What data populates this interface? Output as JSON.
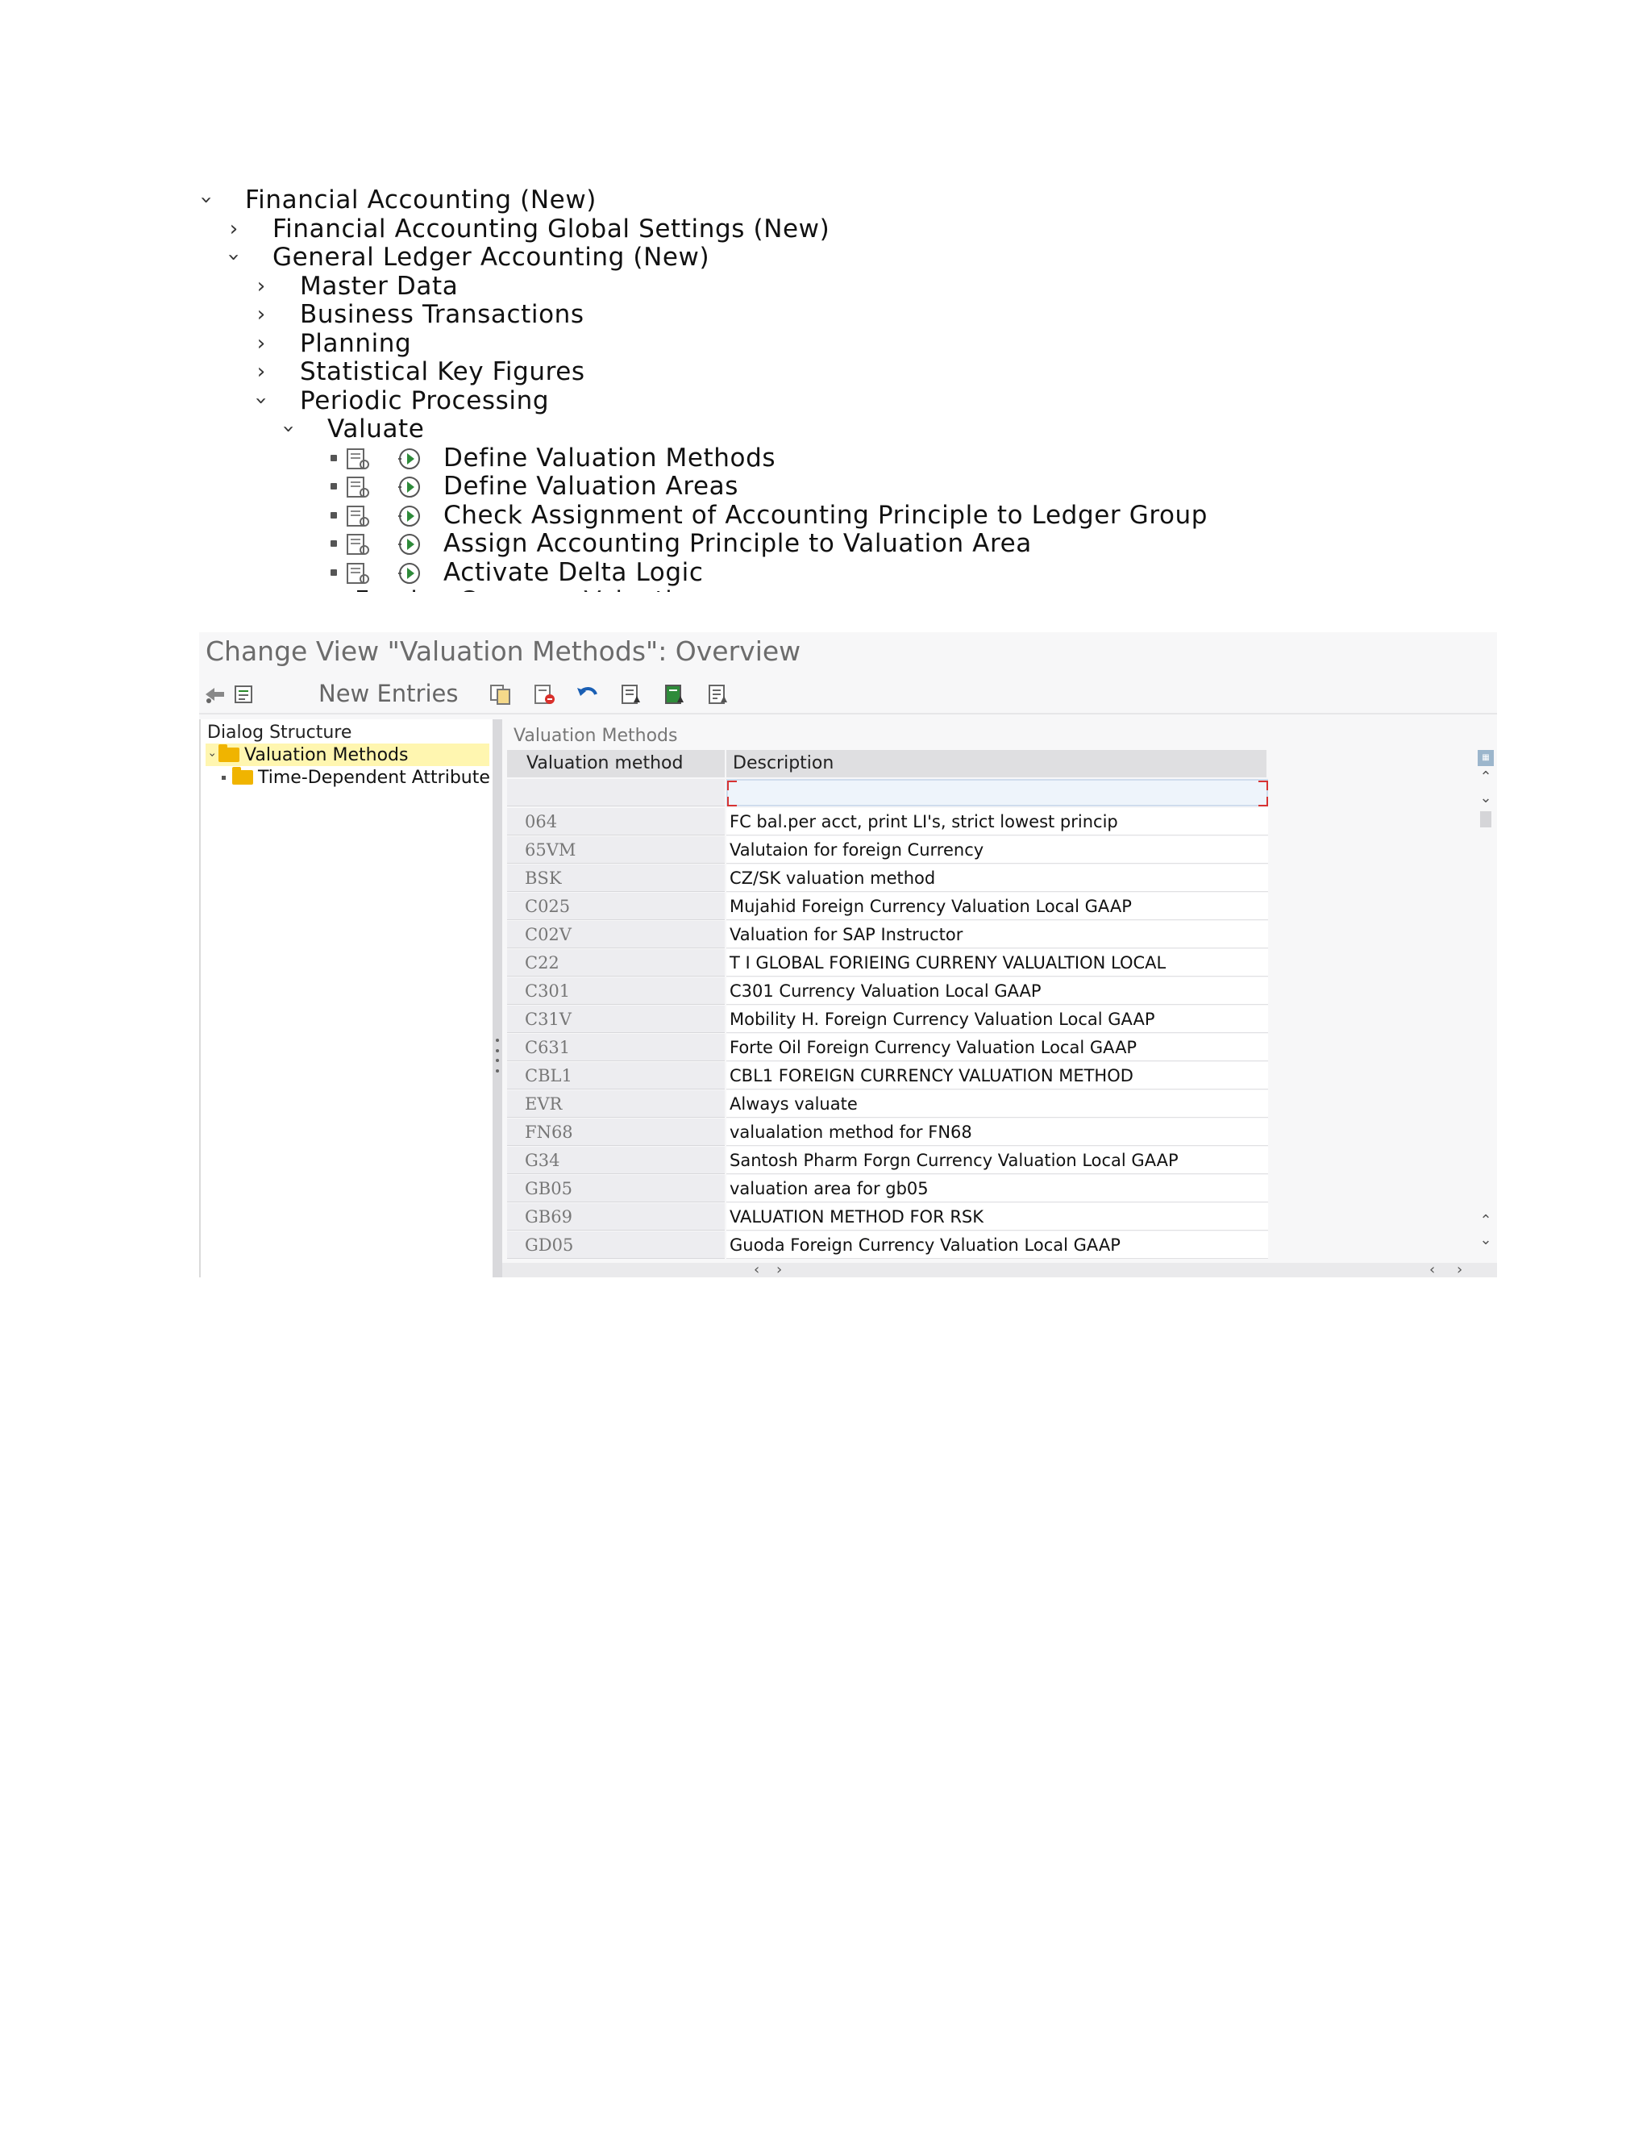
{
  "tree": {
    "nodes": [
      {
        "label": "Financial Accounting (New)",
        "level": 0,
        "state": "expanded"
      },
      {
        "label": "Financial Accounting Global Settings (New)",
        "level": 1,
        "state": "collapsed"
      },
      {
        "label": "General Ledger Accounting (New)",
        "level": 1,
        "state": "expanded"
      },
      {
        "label": "Master Data",
        "level": 2,
        "state": "collapsed"
      },
      {
        "label": "Business Transactions",
        "level": 2,
        "state": "collapsed"
      },
      {
        "label": "Planning",
        "level": 2,
        "state": "collapsed"
      },
      {
        "label": "Statistical Key Figures",
        "level": 2,
        "state": "collapsed"
      },
      {
        "label": "Periodic Processing",
        "level": 2,
        "state": "expanded"
      },
      {
        "label": "Valuate",
        "level": 3,
        "state": "expanded"
      },
      {
        "label": "Define Valuation Methods",
        "level": 4,
        "state": "activity"
      },
      {
        "label": "Define Valuation Areas",
        "level": 4,
        "state": "activity"
      },
      {
        "label": "Check Assignment of Accounting Principle to Ledger Group",
        "level": 4,
        "state": "activity"
      },
      {
        "label": "Assign Accounting Principle to Valuation Area",
        "level": 4,
        "state": "activity"
      },
      {
        "label": "Activate Delta Logic",
        "level": 4,
        "state": "activity"
      },
      {
        "label": "Foreign Currency Valuation",
        "level": 4,
        "state": "collapsed"
      }
    ]
  },
  "sap": {
    "title": "Change View \"Valuation Methods\": Overview",
    "toolbar": {
      "new_entries_label": "New Entries",
      "icons": [
        "display-change-icon",
        "details-icon",
        "copy-icon",
        "delete-icon",
        "undo-icon",
        "select-all-icon",
        "select-block-icon",
        "deselect-all-icon"
      ]
    },
    "dialog_structure": {
      "title": "Dialog Structure",
      "items": [
        {
          "label": "Valuation Methods",
          "selected": true
        },
        {
          "label": "Time-Dependent Attribute",
          "selected": false
        }
      ]
    },
    "table": {
      "section_title": "Valuation Methods",
      "columns": [
        "Valuation method",
        "Description"
      ],
      "rows": [
        {
          "method": "064",
          "description": "FC bal.per acct, print LI's, strict lowest princip"
        },
        {
          "method": "65VM",
          "description": "Valutaion for foreign Currency"
        },
        {
          "method": "BSK",
          "description": "CZ/SK valuation method"
        },
        {
          "method": "C025",
          "description": "Mujahid Foreign Currency Valuation Local GAAP"
        },
        {
          "method": "C02V",
          "description": "Valuation for SAP Instructor"
        },
        {
          "method": "C22",
          "description": "T I GLOBAL FORIEING CURRENY VALUALTION LOCAL"
        },
        {
          "method": "C301",
          "description": "C301 Currency Valuation Local GAAP"
        },
        {
          "method": "C31V",
          "description": "Mobility H. Foreign Currency Valuation Local GAAP"
        },
        {
          "method": "C631",
          "description": "Forte Oil Foreign Currency Valuation Local GAAP"
        },
        {
          "method": "CBL1",
          "description": "CBL1 FOREIGN CURRENCY VALUATION METHOD"
        },
        {
          "method": "EVR",
          "description": "Always valuate"
        },
        {
          "method": "FN68",
          "description": "valualation method for FN68"
        },
        {
          "method": "G34",
          "description": "Santosh Pharm Forgn Currency Valuation Local GAAP"
        },
        {
          "method": "GB05",
          "description": "valuation area for gb05"
        },
        {
          "method": "GB69",
          "description": "VALUATION METHOD FOR RSK"
        },
        {
          "method": "GD05",
          "description": "Guoda Foreign Currency Valuation Local GAAP"
        }
      ]
    }
  }
}
